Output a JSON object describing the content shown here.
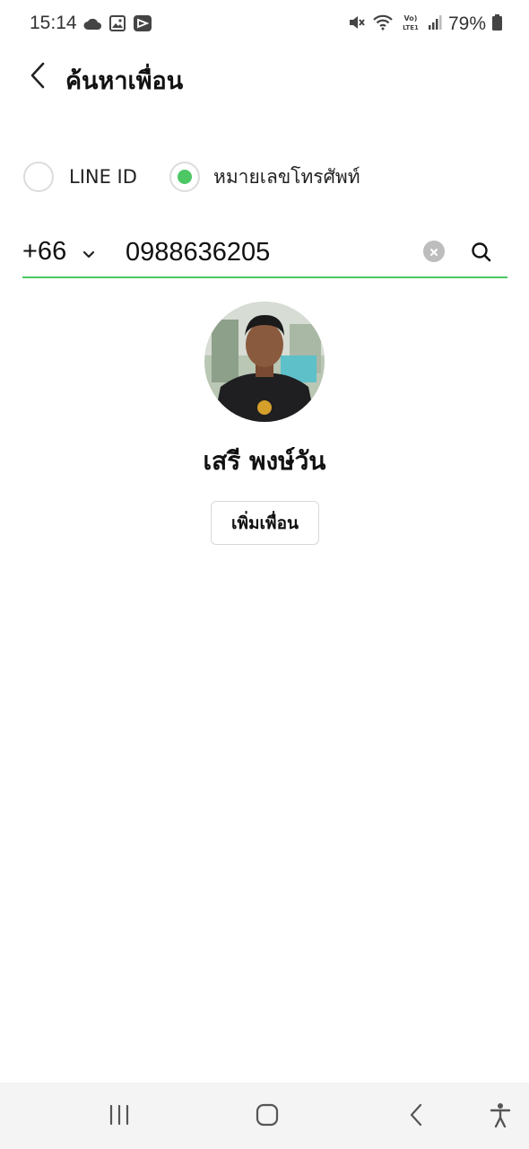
{
  "status_bar": {
    "time": "15:14",
    "battery": "79%",
    "left_icons": [
      "cloud-icon",
      "image-icon",
      "cast-icon"
    ],
    "right_icons": [
      "mute-icon",
      "wifi-icon",
      "volte-icon",
      "signal-icon",
      "battery-icon"
    ]
  },
  "header": {
    "title": "ค้นหาเพื่อน",
    "back_icon": "chevron-left-icon"
  },
  "search_mode": {
    "options": [
      {
        "label": "LINE ID",
        "selected": false
      },
      {
        "label": "หมายเลขโทรศัพท์",
        "selected": true
      }
    ]
  },
  "phone_search": {
    "country_code": "+66",
    "value": "0988636205"
  },
  "result": {
    "name": "เสรี พงษ์วัน",
    "add_button": "เพิ่มเพื่อน"
  },
  "colors": {
    "accent": "#4cc764",
    "nav_background": "#f4f4f4"
  },
  "nav_bar": {
    "icons": [
      "recent-apps-icon",
      "home-icon",
      "back-icon",
      "accessibility-icon"
    ]
  }
}
